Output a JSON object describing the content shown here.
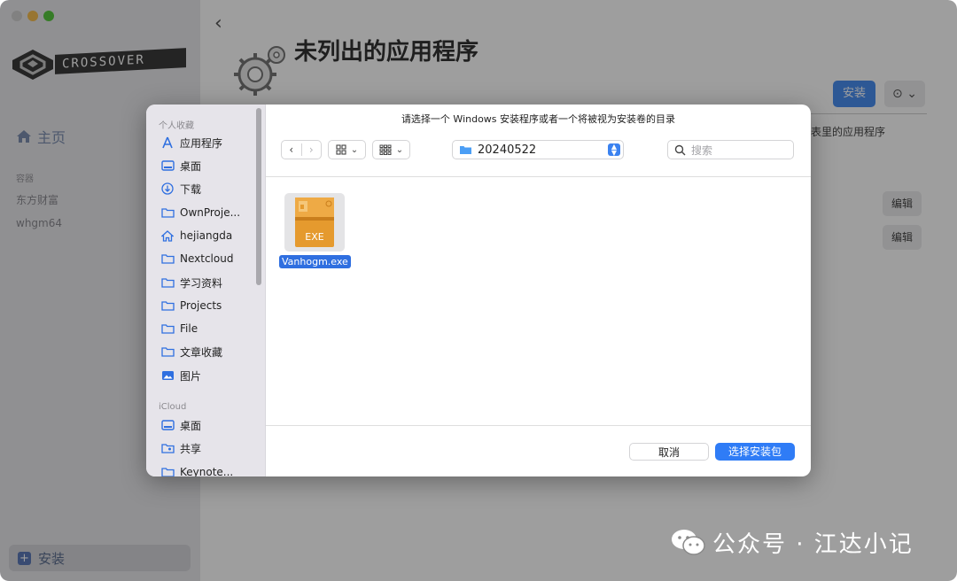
{
  "app": {
    "logo_text": "CROSSOVER",
    "nav_home": "主页",
    "bottles_section": "容器",
    "bottles": [
      "东方财富",
      "whgm64"
    ],
    "install_button": "安装"
  },
  "main": {
    "back": "‹",
    "title": "未列出的应用程序",
    "install_button": "安装",
    "more_button": "⊙ ⌄",
    "hint_text": "表里的应用程序",
    "edit_buttons": [
      "编辑",
      "编辑"
    ]
  },
  "dialog": {
    "title": "请选择一个 Windows 安装程序或者一个将被视为安装卷的目录",
    "sidebar": {
      "favorites_label": "个人收藏",
      "favorites": [
        {
          "label": "应用程序",
          "icon": "apps-icon"
        },
        {
          "label": "桌面",
          "icon": "desktop-icon"
        },
        {
          "label": "下载",
          "icon": "download-icon"
        },
        {
          "label": "OwnProje...",
          "icon": "folder-icon"
        },
        {
          "label": "hejiangda",
          "icon": "home-icon"
        },
        {
          "label": "Nextcloud",
          "icon": "folder-icon"
        },
        {
          "label": "学习资料",
          "icon": "folder-icon"
        },
        {
          "label": "Projects",
          "icon": "folder-icon"
        },
        {
          "label": "File",
          "icon": "folder-icon"
        },
        {
          "label": "文章收藏",
          "icon": "folder-icon"
        },
        {
          "label": "图片",
          "icon": "photos-icon"
        }
      ],
      "icloud_label": "iCloud",
      "icloud": [
        {
          "label": "桌面",
          "icon": "desktop-icon"
        },
        {
          "label": "共享",
          "icon": "shared-folder-icon"
        },
        {
          "label": "Keynote...",
          "icon": "folder-icon"
        }
      ]
    },
    "toolbar": {
      "back": "‹",
      "forward": "›",
      "view_icon_chevron": "⌄",
      "group_chevron": "⌄",
      "path": "20240522",
      "search_placeholder": "搜索"
    },
    "file": {
      "name": "Vanhogm.exe",
      "badge": "EXE"
    },
    "buttons": {
      "cancel": "取消",
      "ok": "选择安装包"
    }
  },
  "watermark": "公众号 · 江达小记",
  "colors": {
    "accent": "#2f7cf6",
    "sidebar_bg": "#e9e8ec",
    "exe_orange": "#e59a2e"
  }
}
